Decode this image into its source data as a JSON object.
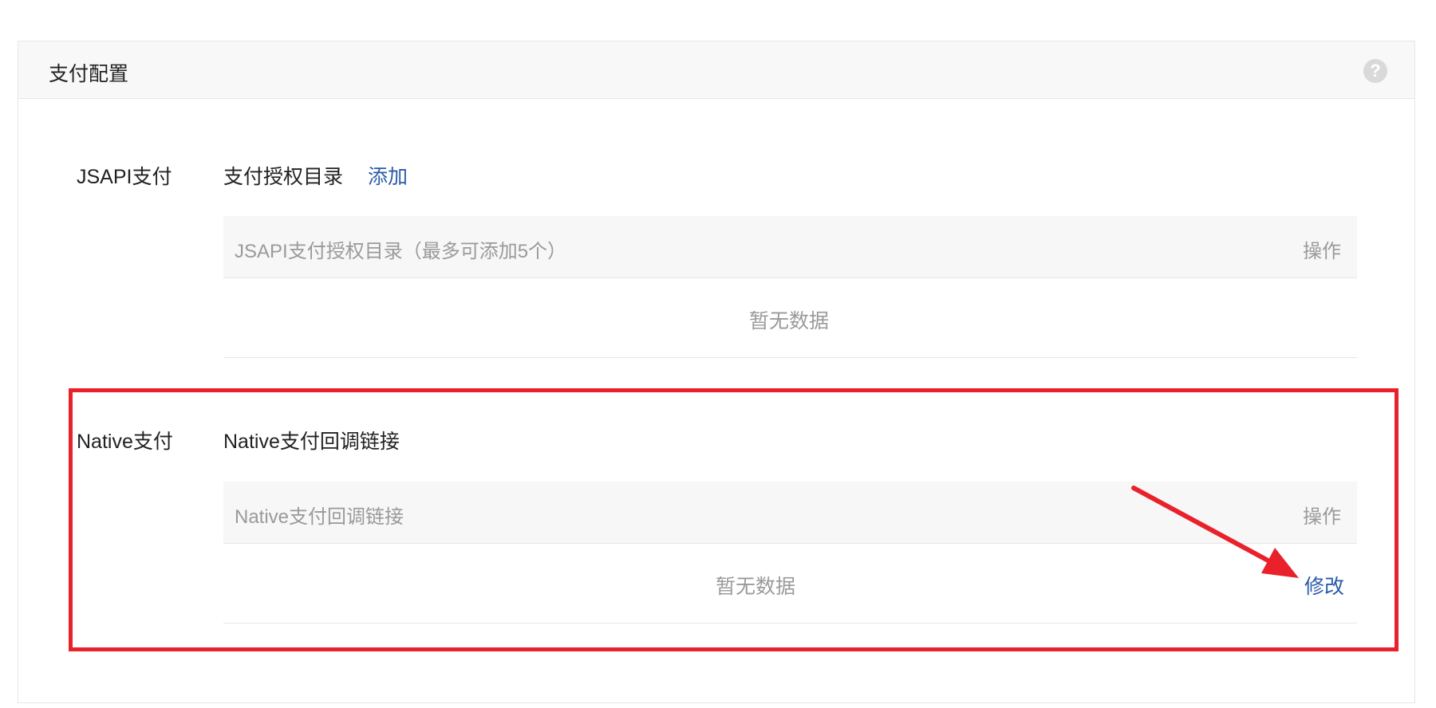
{
  "panel": {
    "title": "支付配置",
    "help_icon": "question-circle-icon",
    "help_glyph": "?"
  },
  "jsapi": {
    "label": "JSAPI支付",
    "subtitle": "支付授权目录",
    "add_link": "添加",
    "table": {
      "header_main": "JSAPI支付授权目录（最多可添加5个）",
      "header_op": "操作",
      "empty_text": "暂无数据"
    }
  },
  "native": {
    "label": "Native支付",
    "subtitle": "Native支付回调链接",
    "table": {
      "header_main": "Native支付回调链接",
      "header_op": "操作",
      "empty_text": "暂无数据",
      "edit_link": "修改"
    }
  },
  "annotation": {
    "highlight_color": "#e8212a",
    "arrow_color": "#e8212a"
  },
  "colors": {
    "link": "#2a5ca8",
    "muted_text": "#9a9a9a"
  }
}
